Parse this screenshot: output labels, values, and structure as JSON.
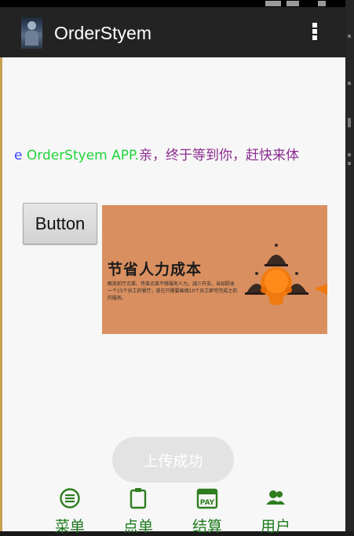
{
  "action_bar": {
    "title": "OrderStyem"
  },
  "marquee": {
    "part1": "e ",
    "part2": "OrderStyem APP.",
    "part3": "亲，终于等到你，赶快来体"
  },
  "button": {
    "label": "Button"
  },
  "banner": {
    "title": "节省人力成本",
    "description": "解放前厅点菜、传菜点菜不够服务人力。减少开支。当如厨本一个15个员工的餐厅，现在只需要雇佣10个员工即可完成之前的服务。"
  },
  "toast": {
    "text": "上传成功"
  },
  "bottom_tabs": [
    {
      "label": "菜单",
      "icon": "menu-list-icon"
    },
    {
      "label": "点单",
      "icon": "clipboard-icon"
    },
    {
      "label": "结算",
      "icon": "pay-icon"
    },
    {
      "label": "用户",
      "icon": "users-icon"
    }
  ],
  "colors": {
    "accent_green": "#2e7d1e",
    "action_bar": "#232323",
    "banner_bg": "#d98f60"
  }
}
